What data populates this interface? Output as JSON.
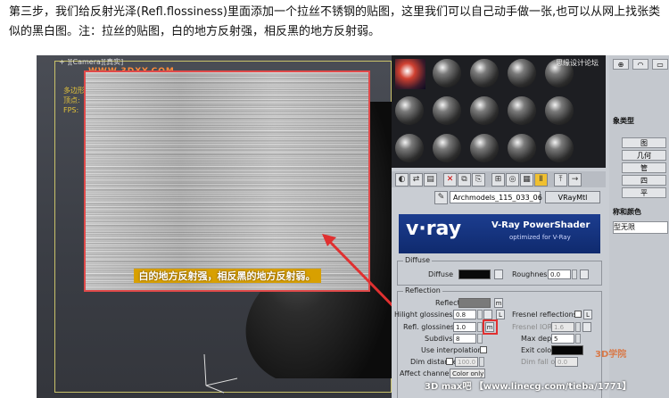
{
  "article": {
    "text": "第三步，我们给反射光泽(Refl.flossiness)里面添加一个拉丝不锈钢的贴图，这里我们可以自己动手做一张,也可以从网上找张类似的黑白图。注：拉丝的贴图，白的地方反射强，相反黑的地方反射弱。"
  },
  "viewport": {
    "label": "+ ][Camera][真实]",
    "watermark": "WWW.3DXY.COM",
    "stats": [
      "多边形:",
      "顶点:",
      "",
      "FPS:"
    ],
    "texture_caption": "白的地方反射强，相反黑的地方反射弱。"
  },
  "material_editor": {
    "top_watermark": "思缘设计论坛",
    "material_name": "Archmodels_115_033_06",
    "material_type": "VRayMtl",
    "banner_logo": "v·ray",
    "banner_title": "V-Ray PowerShader",
    "banner_subtitle": "optimized for V-Ray",
    "diffuse": {
      "group": "Diffuse",
      "label": "Diffuse",
      "roughness_label": "Roughness",
      "roughness_value": "0.0"
    },
    "reflection": {
      "group": "Reflection",
      "reflect_label": "Reflect",
      "hilight_label": "Hilight glossiness",
      "hilight_value": "0.8",
      "refl_gloss_label": "Refl. glossiness",
      "refl_gloss_value": "1.0",
      "map_button": "m",
      "lock_button": "L",
      "subdivs_label": "Subdivs",
      "subdivs_value": "8",
      "use_interp_label": "Use interpolation",
      "dim_distance_label": "Dim distance",
      "dim_distance_value": "100.0",
      "affect_channels_label": "Affect channels",
      "affect_channels_value": "Color only",
      "fresnel_label": "Fresnel reflections",
      "fresnel_ior_label": "Fresnel IOR",
      "fresnel_ior_value": "1.6",
      "max_depth_label": "Max depth",
      "max_depth_value": "5",
      "exit_color_label": "Exit color",
      "dim_falloff_label": "Dim fall off",
      "dim_falloff_value": "0.0"
    },
    "colors": {
      "diffuse_swatch": "#0a0a0a",
      "reflect_swatch": "#7a7a7a",
      "exit_swatch": "#050505",
      "highlight": "#e03030"
    }
  },
  "command_panel": {
    "items": [
      "象类型",
      "图",
      "几何",
      "管",
      "四",
      "平"
    ],
    "name_color_label": "称和颜色",
    "name_value": "型无限"
  },
  "footer": {
    "watermark": "3D max吧 【www.linecg.com/tieba/1771】",
    "logo": "3D学院"
  }
}
